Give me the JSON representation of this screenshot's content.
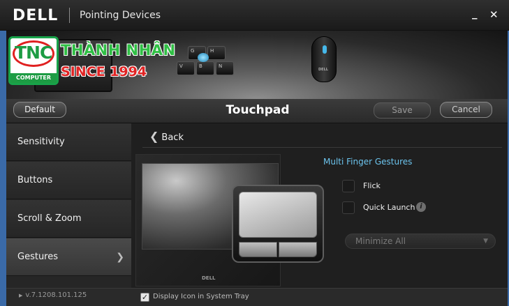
{
  "window": {
    "brand_logo": "DELL",
    "title": "Pointing Devices",
    "minimize_glyph": "_",
    "close_glyph": "✕"
  },
  "banner": {
    "logo_text": "TNC",
    "logo_sub": "COMPUTER",
    "brand_name": "THÀNH NHÂN",
    "brand_since": "SINCE 1994",
    "keys": [
      "G",
      "H",
      "V",
      "B",
      "N"
    ],
    "mouse_logo": "DELL"
  },
  "toolbar": {
    "default_label": "Default",
    "page_title": "Touchpad",
    "save_label": "Save",
    "cancel_label": "Cancel"
  },
  "sidebar": {
    "items": [
      {
        "label": "Sensitivity"
      },
      {
        "label": "Buttons"
      },
      {
        "label": "Scroll & Zoom"
      },
      {
        "label": "Gestures",
        "active": true
      }
    ]
  },
  "content": {
    "back_label": "Back",
    "preview_logo": "DELL",
    "section_title": "Multi Finger Gestures",
    "options": [
      {
        "label": "Flick",
        "checked": false
      },
      {
        "label": "Quick Launch",
        "checked": false,
        "info": true
      }
    ],
    "action_select": {
      "value": "Minimize All"
    }
  },
  "status": {
    "version": "v.7.1208.101.125",
    "tray_label": "Display Icon in System Tray",
    "tray_checked": true
  },
  "colors": {
    "accent_blue": "#6cc4ee",
    "frame_blue": "#3a6aa8",
    "brand_green": "#2fbf44",
    "brand_red": "#e02424"
  }
}
